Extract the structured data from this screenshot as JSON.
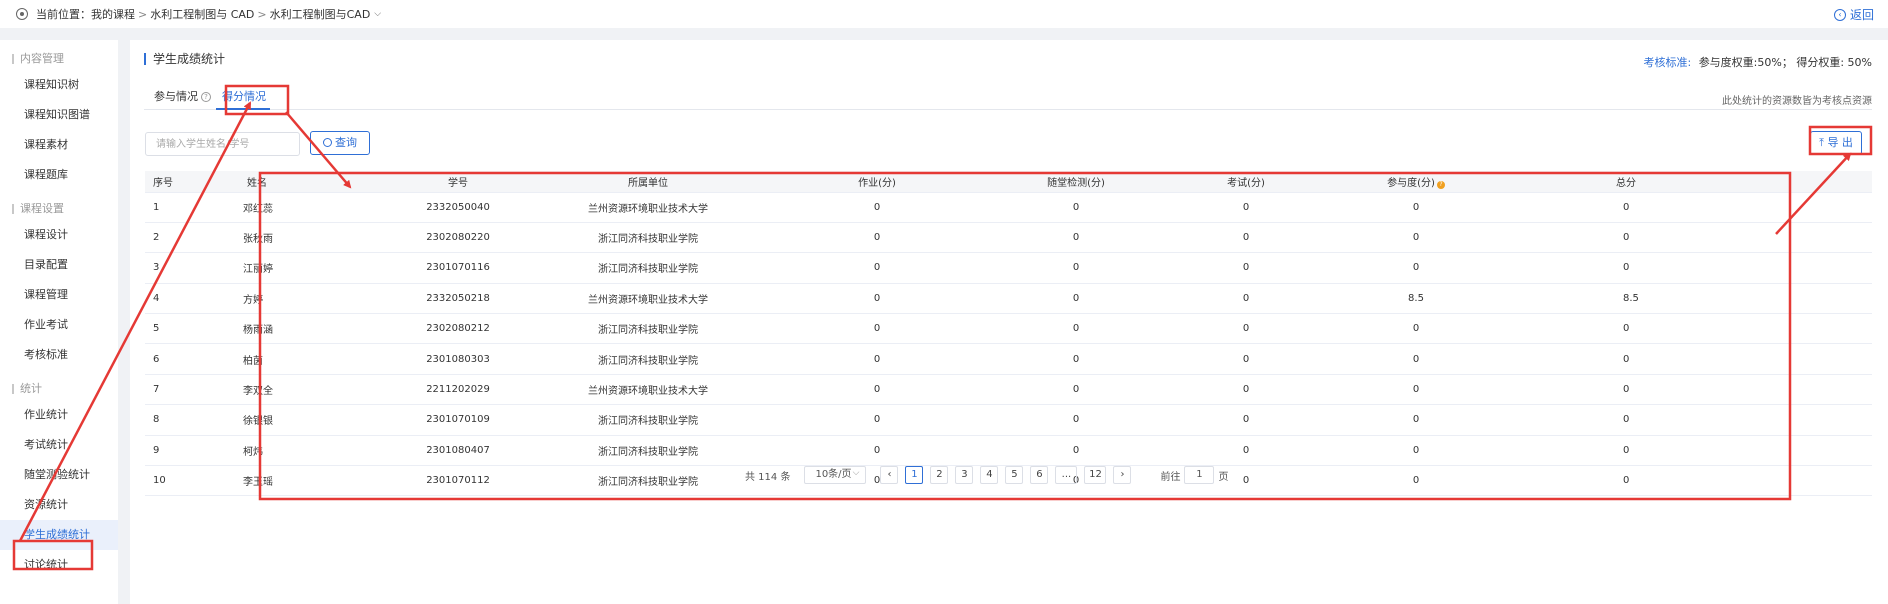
{
  "breadcrumb": {
    "prefix": "当前位置：",
    "items": [
      "我的课程",
      "水利工程制图与 CAD",
      "水利工程制图与CAD"
    ],
    "separator": ">",
    "back_label": "返回"
  },
  "sidebar": {
    "groups": [
      {
        "label": "内容管理",
        "items": [
          "课程知识树",
          "课程知识图谱",
          "课程素材",
          "课程题库"
        ]
      },
      {
        "label": "课程设置",
        "items": [
          "课程设计",
          "目录配置",
          "课程管理",
          "作业考试",
          "考核标准"
        ]
      },
      {
        "label": "统计",
        "items": [
          "作业统计",
          "考试统计",
          "随堂测验统计",
          "资源统计",
          "学生成绩统计",
          "讨论统计"
        ]
      }
    ],
    "active_item": "学生成绩统计"
  },
  "page": {
    "title": "学生成绩统计",
    "criteria_label": "考核标准:",
    "criteria_value": "参与度权重:50%；  得分权重: 50%",
    "tabs": [
      "参与情况",
      "得分情况"
    ],
    "active_tab": "得分情况",
    "tab_note": "此处统计的资源数皆为考核点资源",
    "search_placeholder": "请输入学生姓名/学号",
    "query_label": "查询",
    "export_label": "导 出"
  },
  "table": {
    "columns": [
      "序号",
      "姓名",
      "学号",
      "所属单位",
      "作业(分)",
      "随堂检测(分)",
      "考试(分)",
      "参与度(分)",
      "总分"
    ],
    "rows": [
      [
        "1",
        "邓红蕊",
        "2332050040",
        "兰州资源环境职业技术大学",
        "0",
        "0",
        "0",
        "0",
        "0"
      ],
      [
        "2",
        "张秋雨",
        "2302080220",
        "浙江同济科技职业学院",
        "0",
        "0",
        "0",
        "0",
        "0"
      ],
      [
        "3",
        "江丽婷",
        "2301070116",
        "浙江同济科技职业学院",
        "0",
        "0",
        "0",
        "0",
        "0"
      ],
      [
        "4",
        "方婷",
        "2332050218",
        "兰州资源环境职业技术大学",
        "0",
        "0",
        "0",
        "8.5",
        "8.5"
      ],
      [
        "5",
        "杨雨涵",
        "2302080212",
        "浙江同济科技职业学院",
        "0",
        "0",
        "0",
        "0",
        "0"
      ],
      [
        "6",
        "柏茵",
        "2301080303",
        "浙江同济科技职业学院",
        "0",
        "0",
        "0",
        "0",
        "0"
      ],
      [
        "7",
        "李双全",
        "2211202029",
        "兰州资源环境职业技术大学",
        "0",
        "0",
        "0",
        "0",
        "0"
      ],
      [
        "8",
        "徐银银",
        "2301070109",
        "浙江同济科技职业学院",
        "0",
        "0",
        "0",
        "0",
        "0"
      ],
      [
        "9",
        "柯炜",
        "2301080407",
        "浙江同济科技职业学院",
        "0",
        "0",
        "0",
        "0",
        "0"
      ],
      [
        "10",
        "李玉瑶",
        "2301070112",
        "浙江同济科技职业学院",
        "0",
        "0",
        "0",
        "0",
        "0"
      ]
    ]
  },
  "pagination": {
    "total_text": "共 114 条",
    "page_size": "10条/页",
    "pages": [
      "1",
      "2",
      "3",
      "4",
      "5",
      "6",
      "...",
      "12"
    ],
    "current_page": "1",
    "goto_prefix": "前往",
    "goto_value": "1",
    "goto_suffix": "页"
  },
  "annotation_color": "#e53935",
  "accent_color": "#2f6fd6"
}
